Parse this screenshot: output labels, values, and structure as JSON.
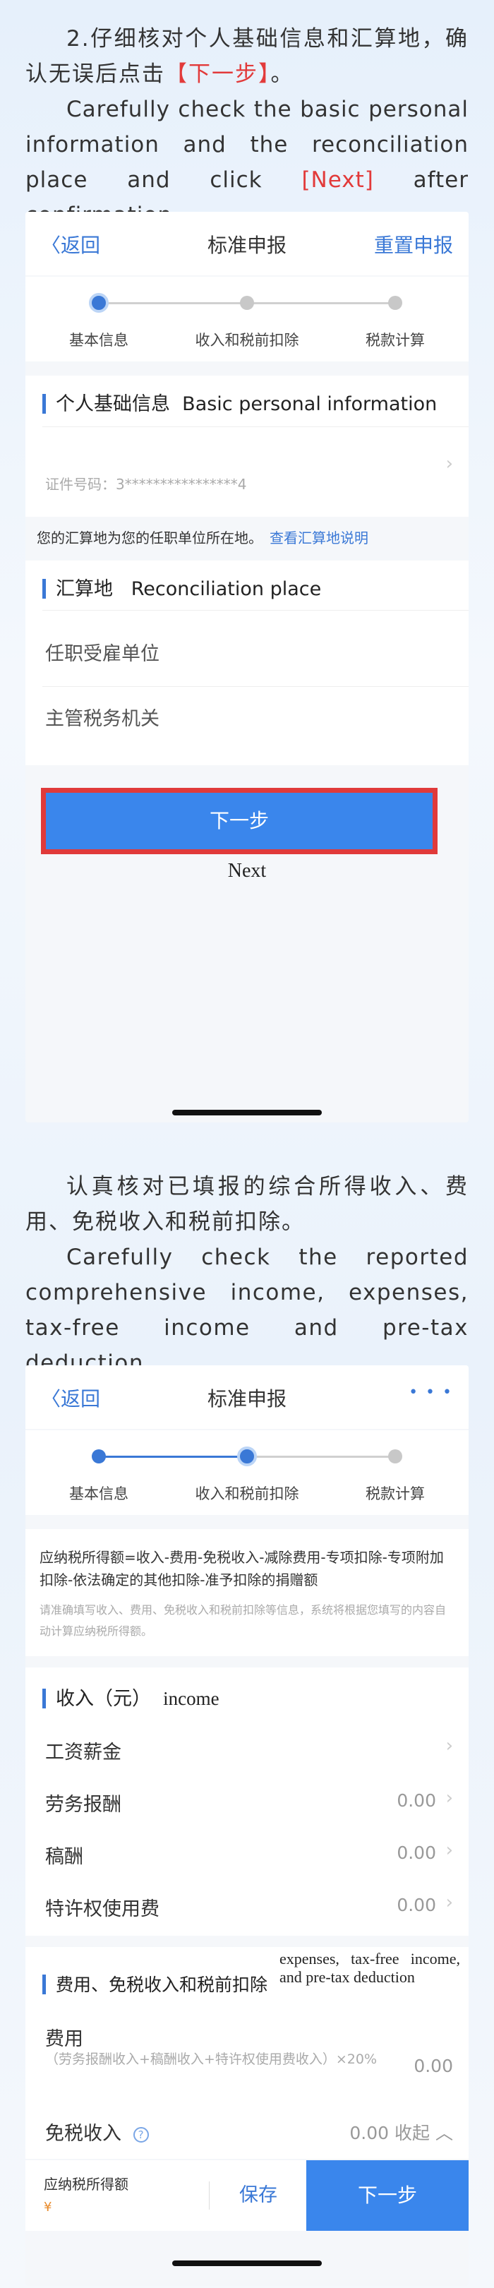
{
  "section1": {
    "zh_prefix": "2.仔细核对个人基础信息和汇算地，确认无误后点击",
    "zh_red": "【下一步】",
    "zh_suffix": "。",
    "en_prefix": "Carefully check the basic personal information and the reconciliation place and click ",
    "en_red": "[Next]",
    "en_suffix": " after confirmation."
  },
  "screen1": {
    "back": "返回",
    "title": "标准申报",
    "right": "重置申报",
    "steps": [
      "基本信息",
      "收入和税前扣除",
      "税款计算"
    ],
    "basic_title": "个人基础信息",
    "basic_title_en": "Basic personal information",
    "id_label": "证件号码：3****************4",
    "notice": "您的汇算地为您的任职单位所在地。",
    "notice_link": "查看汇算地说明",
    "recon_title": "汇算地",
    "recon_title_en": "Reconciliation place",
    "employer_label": "任职受雇单位",
    "tax_office_label": "主管税务机关",
    "next_button": "下一步",
    "next_caption": "Next"
  },
  "section2": {
    "zh": "认真核对已填报的综合所得收入、费用、免税收入和税前扣除。",
    "en": "Carefully check the reported comprehensive income, expenses, tax-free income and pre-tax deduction."
  },
  "screen2": {
    "back": "返回",
    "title": "标准申报",
    "more": "• • •",
    "steps": [
      "基本信息",
      "收入和税前扣除",
      "税款计算"
    ],
    "formula": "应纳税所得额=收入-费用-免税收入-减除费用-专项扣除-专项附加扣除-依法确定的其他扣除-准予扣除的捐赠额",
    "formula_note": "请准确填写收入、费用、免税收入和税前扣除等信息，系统将根据您填写的内容自动计算应纳税所得额。",
    "income_title": "收入（元）",
    "income_title_en": "income",
    "income_rows": [
      {
        "label": "工资薪金",
        "value": ""
      },
      {
        "label": "劳务报酬",
        "value": "0.00"
      },
      {
        "label": "稿酬",
        "value": "0.00"
      },
      {
        "label": "特许权使用费",
        "value": "0.00"
      }
    ],
    "expense_title": "费用、免税收入和税前扣除",
    "expense_title_en": "expenses, tax-free income, and pre-tax deduction",
    "fee_label": "费用",
    "fee_note": "（劳务报酬收入+稿酬收入+特许权使用费收入）×20%",
    "fee_value": "0.00",
    "taxfree_label": "免税收入",
    "taxfree_value": "0.00",
    "taxfree_toggle": "收起",
    "bottom_label": "应纳税所得额",
    "bottom_currency": "¥",
    "save_button": "保存",
    "next_button": "下一步"
  }
}
